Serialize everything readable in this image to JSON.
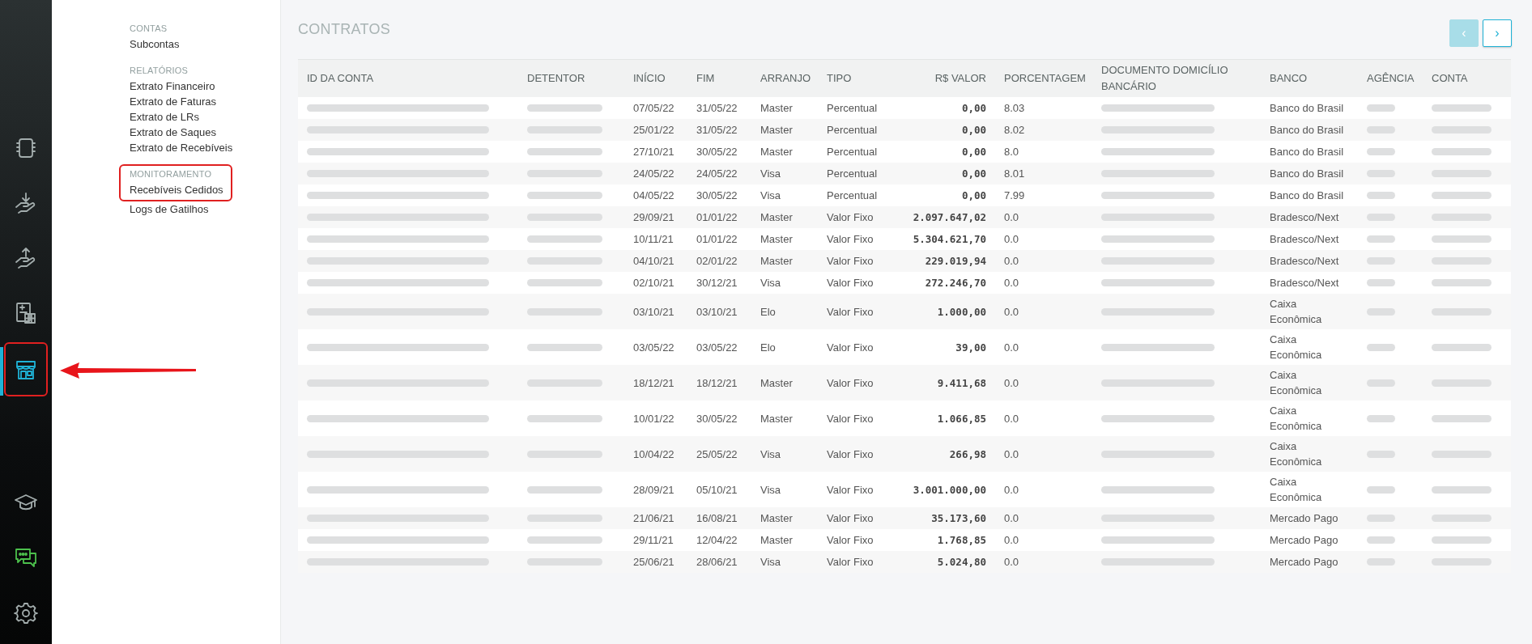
{
  "rail": {
    "items": [
      {
        "kind": "notebook",
        "selected": false,
        "highlighted": false
      },
      {
        "kind": "hand-down",
        "selected": false,
        "highlighted": false
      },
      {
        "kind": "hand-up",
        "selected": false,
        "highlighted": false
      },
      {
        "kind": "calculator",
        "selected": false,
        "highlighted": false
      },
      {
        "kind": "store",
        "selected": true,
        "highlighted": true
      }
    ],
    "bottom_items": [
      {
        "kind": "cap",
        "selected": false,
        "highlighted": false
      },
      {
        "kind": "chat",
        "selected": false,
        "highlighted": false
      },
      {
        "kind": "gear",
        "selected": false,
        "highlighted": false
      }
    ]
  },
  "annotations": [
    {
      "kind": "arrow"
    }
  ],
  "menu": {
    "sections": [
      {
        "heading": "CONTAS",
        "highlighted": false,
        "items": [
          "Subcontas"
        ]
      },
      {
        "heading": "RELATÓRIOS",
        "highlighted": false,
        "items": [
          "Extrato Financeiro",
          "Extrato de Faturas",
          "Extrato de LRs",
          "Extrato de Saques",
          "Extrato de Recebíveis"
        ]
      },
      {
        "heading": "MONITORAMENTO",
        "highlighted": true,
        "items": [
          "Recebíveis Cedidos",
          "Logs de Gatilhos"
        ]
      }
    ]
  },
  "page": {
    "title": "CONTRATOS"
  },
  "pagination": [
    {
      "label": "‹",
      "disabled": true
    },
    {
      "label": "›",
      "disabled": false
    }
  ],
  "table": {
    "columns": [
      {
        "label": "ID DA CONTA",
        "kind": "redacted"
      },
      {
        "label": "DETENTOR",
        "kind": "redacted"
      },
      {
        "label": "INÍCIO",
        "kind": "text"
      },
      {
        "label": "FIM",
        "kind": "text"
      },
      {
        "label": "ARRANJO",
        "kind": "text"
      },
      {
        "label": "TIPO",
        "kind": "text"
      },
      {
        "label": "R$ VALOR",
        "kind": "money"
      },
      {
        "label": "PORCENTAGEM",
        "kind": "text"
      },
      {
        "label": "DOCUMENTO DOMICÍLIO BANCÁRIO",
        "kind": "redacted"
      },
      {
        "label": "BANCO",
        "kind": "text"
      },
      {
        "label": "AGÊNCIA",
        "kind": "redacted"
      },
      {
        "label": "CONTA",
        "kind": "redacted"
      }
    ],
    "rows": [
      {
        "cells": [
          "",
          "",
          "07/05/22",
          "31/05/22",
          "Master",
          "Percentual",
          "0,00",
          "8.03",
          "",
          "Banco do Brasil",
          "",
          ""
        ]
      },
      {
        "cells": [
          "",
          "",
          "25/01/22",
          "31/05/22",
          "Master",
          "Percentual",
          "0,00",
          "8.02",
          "",
          "Banco do Brasil",
          "",
          ""
        ]
      },
      {
        "cells": [
          "",
          "",
          "27/10/21",
          "30/05/22",
          "Master",
          "Percentual",
          "0,00",
          "8.0",
          "",
          "Banco do Brasil",
          "",
          ""
        ]
      },
      {
        "cells": [
          "",
          "",
          "24/05/22",
          "24/05/22",
          "Visa",
          "Percentual",
          "0,00",
          "8.01",
          "",
          "Banco do Brasil",
          "",
          ""
        ]
      },
      {
        "cells": [
          "",
          "",
          "04/05/22",
          "30/05/22",
          "Visa",
          "Percentual",
          "0,00",
          "7.99",
          "",
          "Banco do Brasil",
          "",
          ""
        ]
      },
      {
        "cells": [
          "",
          "",
          "29/09/21",
          "01/01/22",
          "Master",
          "Valor Fixo",
          "2.097.647,02",
          "0.0",
          "",
          "Bradesco/Next",
          "",
          ""
        ]
      },
      {
        "cells": [
          "",
          "",
          "10/11/21",
          "01/01/22",
          "Master",
          "Valor Fixo",
          "5.304.621,70",
          "0.0",
          "",
          "Bradesco/Next",
          "",
          ""
        ]
      },
      {
        "cells": [
          "",
          "",
          "04/10/21",
          "02/01/22",
          "Master",
          "Valor Fixo",
          "229.019,94",
          "0.0",
          "",
          "Bradesco/Next",
          "",
          ""
        ]
      },
      {
        "cells": [
          "",
          "",
          "02/10/21",
          "30/12/21",
          "Visa",
          "Valor Fixo",
          "272.246,70",
          "0.0",
          "",
          "Bradesco/Next",
          "",
          ""
        ]
      },
      {
        "cells": [
          "",
          "",
          "03/10/21",
          "03/10/21",
          "Elo",
          "Valor Fixo",
          "1.000,00",
          "0.0",
          "",
          "Caixa Econômica",
          "",
          ""
        ]
      },
      {
        "cells": [
          "",
          "",
          "03/05/22",
          "03/05/22",
          "Elo",
          "Valor Fixo",
          "39,00",
          "0.0",
          "",
          "Caixa Econômica",
          "",
          ""
        ]
      },
      {
        "cells": [
          "",
          "",
          "18/12/21",
          "18/12/21",
          "Master",
          "Valor Fixo",
          "9.411,68",
          "0.0",
          "",
          "Caixa Econômica",
          "",
          ""
        ]
      },
      {
        "cells": [
          "",
          "",
          "10/01/22",
          "30/05/22",
          "Master",
          "Valor Fixo",
          "1.066,85",
          "0.0",
          "",
          "Caixa Econômica",
          "",
          ""
        ]
      },
      {
        "cells": [
          "",
          "",
          "10/04/22",
          "25/05/22",
          "Visa",
          "Valor Fixo",
          "266,98",
          "0.0",
          "",
          "Caixa Econômica",
          "",
          ""
        ]
      },
      {
        "cells": [
          "",
          "",
          "28/09/21",
          "05/10/21",
          "Visa",
          "Valor Fixo",
          "3.001.000,00",
          "0.0",
          "",
          "Caixa Econômica",
          "",
          ""
        ]
      },
      {
        "cells": [
          "",
          "",
          "21/06/21",
          "16/08/21",
          "Master",
          "Valor Fixo",
          "35.173,60",
          "0.0",
          "",
          "Mercado Pago",
          "",
          ""
        ]
      },
      {
        "cells": [
          "",
          "",
          "29/11/21",
          "12/04/22",
          "Master",
          "Valor Fixo",
          "1.768,85",
          "0.0",
          "",
          "Mercado Pago",
          "",
          ""
        ]
      },
      {
        "cells": [
          "",
          "",
          "25/06/21",
          "28/06/21",
          "Visa",
          "Valor Fixo",
          "5.024,80",
          "0.0",
          "",
          "Mercado Pago",
          "",
          ""
        ]
      }
    ]
  }
}
